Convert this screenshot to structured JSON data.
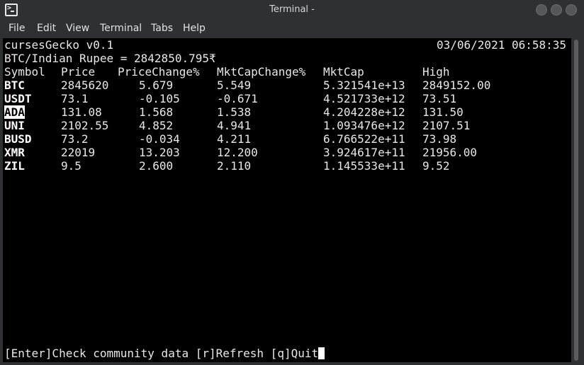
{
  "window": {
    "title": "Terminal -"
  },
  "menu": [
    "File",
    "Edit",
    "View",
    "Terminal",
    "Tabs",
    "Help"
  ],
  "terminal": {
    "app_name": "cursesGecko v0.1",
    "datetime": "03/06/2021 06:58:35",
    "rate_line": "BTC/Indian Rupee = 2842850.795₹",
    "headers": [
      "Symbol",
      "Price",
      "PriceChange%",
      "MktCapChange%",
      "MktCap",
      "High"
    ],
    "rows": [
      [
        "BTC",
        "2845620",
        "5.679",
        "5.549",
        "5.321541e+13",
        "2849152.00"
      ],
      [
        "USDT",
        "73.1",
        "-0.105",
        "-0.671",
        "4.521733e+12",
        "73.51"
      ],
      [
        "ADA",
        "131.08",
        "1.568",
        "1.538",
        "4.204228e+12",
        "131.50"
      ],
      [
        "UNI",
        "2102.55",
        "4.852",
        "4.941",
        "1.093476e+12",
        "2107.51"
      ],
      [
        "BUSD",
        "73.2",
        "-0.034",
        "4.211",
        "6.766522e+11",
        "73.98"
      ],
      [
        "XMR",
        "22019",
        "13.203",
        "12.200",
        "3.924617e+11",
        "21956.00"
      ],
      [
        "ZIL",
        "9.5",
        "2.600",
        "2.110",
        "1.145533e+11",
        "9.52"
      ]
    ],
    "selected_row": 2,
    "footer": "[Enter]Check community data [r]Refresh [q]Quit"
  }
}
